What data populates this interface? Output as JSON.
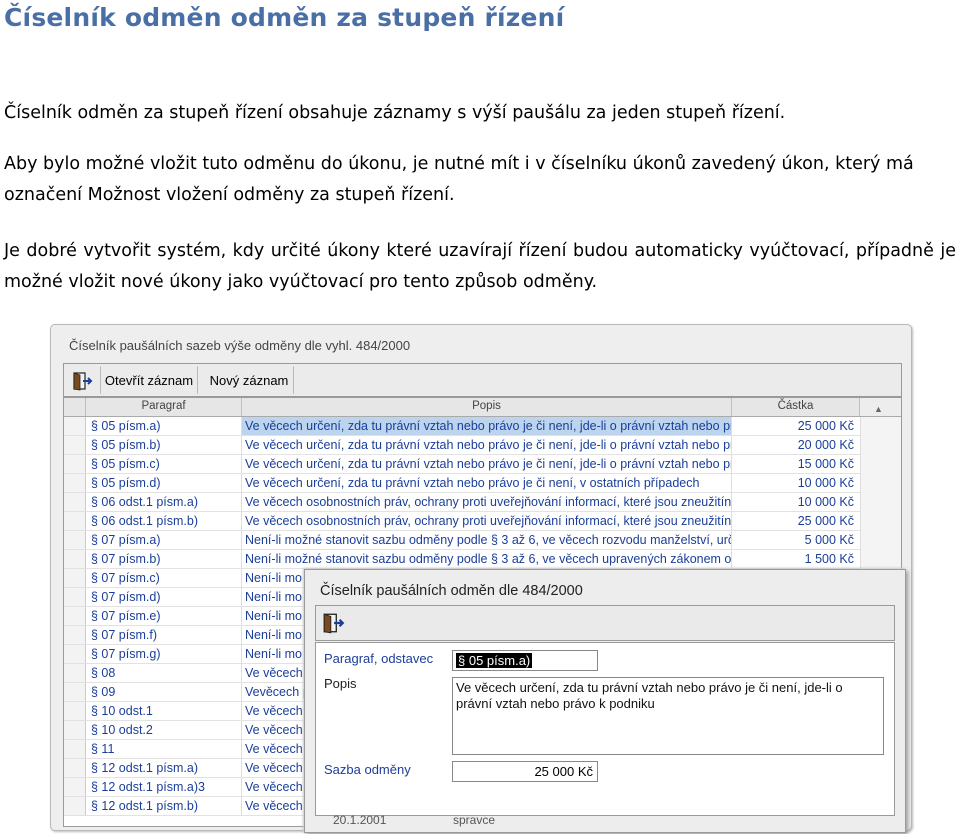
{
  "document": {
    "title": "Číselník odměn odměn za stupeň řízení",
    "paragraph1": "Číselník odměn za stupeň řízení obsahuje záznamy s výší paušálu za jeden stupeň řízení.",
    "paragraph2": "Aby bylo možné vložit tuto odměnu do úkonu, je nutné mít i v číselníku úkonů zavedený úkon, který má označení Možnost vložení odměny za stupeň řízení.",
    "paragraph3": "Je dobré vytvořit systém, kdy určité úkony které uzavírají řízení budou automaticky vyúčtovací, případně je možné vložit nové úkony jako vyúčtovací pro tento způsob odměny."
  },
  "main_window": {
    "title": "Číselník paušálních sazeb výše odměny dle vyhl. 484/2000",
    "toolbar": {
      "exit_icon": "exit-door-icon",
      "open_label": "Otevřít záznam",
      "new_label": "Nový záznam"
    },
    "columns": [
      "Paragraf",
      "Popis",
      "Částka"
    ],
    "rows": [
      {
        "paragraf": "§ 05 písm.a)",
        "popis": "Ve věcech určení, zda tu právní vztah nebo právo je či není, jde-li o právní vztah nebo pr",
        "castka": "25 000 Kč"
      },
      {
        "paragraf": "§ 05 písm.b)",
        "popis": "Ve věcech určení, zda tu právní vztah nebo právo je či není, jde-li o právní vztah nebo pr",
        "castka": "20 000 Kč"
      },
      {
        "paragraf": "§ 05 písm.c)",
        "popis": "Ve věcech určení, zda tu právní vztah nebo právo je či není, jde-li o právní vztah nebo pr",
        "castka": "15 000 Kč"
      },
      {
        "paragraf": "§ 05 písm.d)",
        "popis": "Ve věcech určení, zda tu právní vztah nebo právo je či není, v ostatních případech",
        "castka": "10 000 Kč"
      },
      {
        "paragraf": "§ 06 odst.1 písm.a)",
        "popis": "Ve věcech osobnostních práv, ochrany proti uveřejňování informací, které jsou zneužitín",
        "castka": "10 000 Kč"
      },
      {
        "paragraf": "§ 06 odst.1 písm.b)",
        "popis": "Ve věcech osobnostních práv, ochrany proti uveřejňování informací, které jsou zneužitín",
        "castka": "25 000 Kč"
      },
      {
        "paragraf": "§ 07 písm.a)",
        "popis": "Není-li možné stanovit sazbu odměny podle § 3 až 6, ve věcech rozvodu manželství, urče",
        "castka": "5 000 Kč"
      },
      {
        "paragraf": "§ 07 písm.b)",
        "popis": "Není-li možné stanovit sazbu odměny podle § 3 až 6, ve věcech upravených zákonem o r",
        "castka": "1 500 Kč"
      },
      {
        "paragraf": "§ 07 písm.c)",
        "popis": "Není-li mo",
        "castka": ""
      },
      {
        "paragraf": "§ 07 písm.d)",
        "popis": "Není-li mo",
        "castka": ""
      },
      {
        "paragraf": "§ 07 písm.e)",
        "popis": "Není-li mo",
        "castka": ""
      },
      {
        "paragraf": "§ 07 písm.f)",
        "popis": "Není-li mo",
        "castka": ""
      },
      {
        "paragraf": "§ 07 písm.g)",
        "popis": "Není-li mo",
        "castka": ""
      },
      {
        "paragraf": "§ 08",
        "popis": "Ve věcech,",
        "castka": ""
      },
      {
        "paragraf": "§ 09",
        "popis": "Vevěcech p",
        "castka": ""
      },
      {
        "paragraf": "§ 10 odst.1",
        "popis": "Ve věcech",
        "castka": ""
      },
      {
        "paragraf": "§ 10 odst.2",
        "popis": "Ve věcech",
        "castka": ""
      },
      {
        "paragraf": "§ 11",
        "popis": "Ve věcech",
        "castka": ""
      },
      {
        "paragraf": "§ 12 odst.1 písm.a)",
        "popis": "Ve věcech",
        "castka": ""
      },
      {
        "paragraf": "§ 12 odst.1 písm.a)3",
        "popis": "Ve věcech",
        "castka": ""
      },
      {
        "paragraf": "§ 12 odst.1 písm.b)",
        "popis": "Ve věcech",
        "castka": ""
      }
    ]
  },
  "dialog": {
    "title": "Číselník paušálních odměn dle  484/2000",
    "exit_icon": "exit-door-icon",
    "paragraf_label": "Paragraf, odstavec",
    "paragraf_value": "§ 05 písm.a)",
    "popis_label": "Popis",
    "popis_value": "Ve věcech určení, zda tu právní vztah nebo právo je či není, jde-li o právní vztah nebo právo k podniku",
    "sazba_label": "Sazba odměny",
    "sazba_value": "25 000 Kč",
    "footer_date": "20.1.2001",
    "footer_user": "spravce"
  },
  "colors": {
    "title": "#4a6fa5",
    "grid_text": "#1a3e9a",
    "selection": "#bcd4ee"
  }
}
